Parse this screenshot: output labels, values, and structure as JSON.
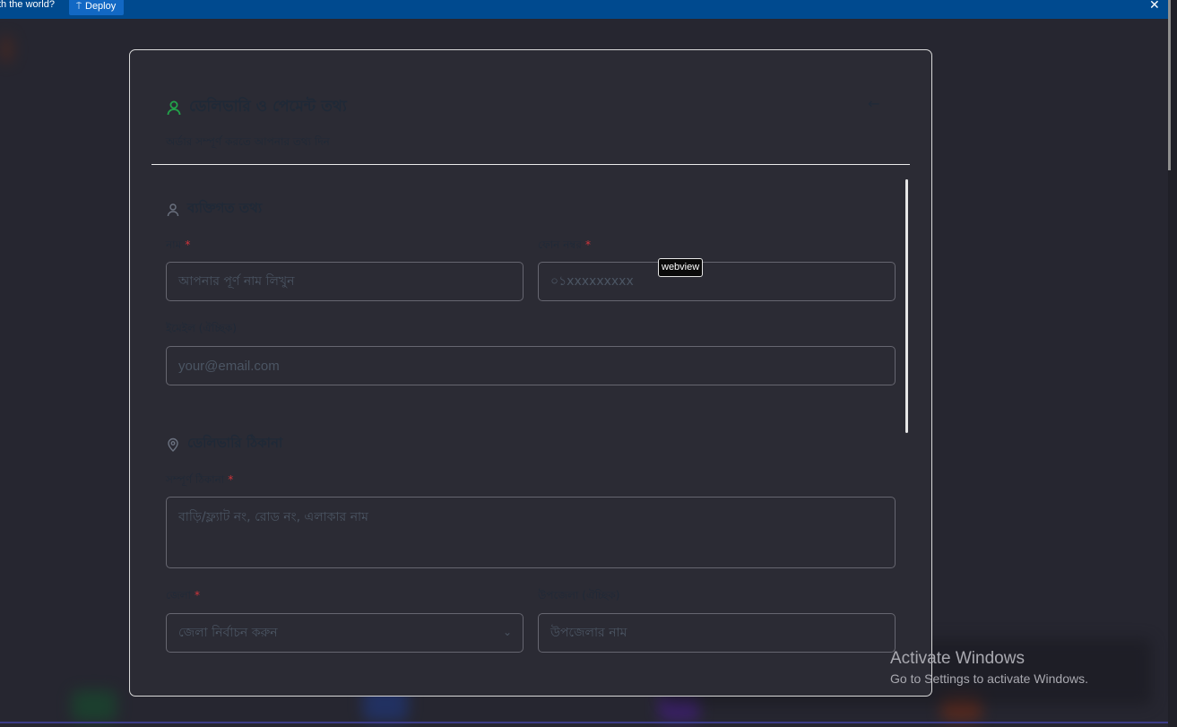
{
  "topbar": {
    "message": "th the world?",
    "deploy_label": "Deploy",
    "close_glyph": "✕"
  },
  "modal": {
    "title": "ডেলিভারি ও পেমেন্ট তথ্য",
    "subtitle": "অর্ডার সম্পূর্ণ করতে আপনার তথ্য দিন",
    "back_glyph": "←",
    "personal": {
      "section_title": "ব্যক্তিগত তথ্য",
      "name_label": "নাম",
      "name_placeholder": "আপনার পূর্ণ নাম লিখুন",
      "phone_label": "ফোন নম্বর",
      "phone_placeholder": "০১xxxxxxxxx",
      "email_label": "ইমেইল (ঐচ্ছিক)",
      "email_placeholder": "your@email.com",
      "required_mark": "*"
    },
    "address": {
      "section_title": "ডেলিভারি ঠিকানা",
      "full_address_label": "সম্পূর্ণ ঠিকানা",
      "full_address_placeholder": "বাড়ি/ফ্ল্যাট নং, রোড নং, এলাকার নাম",
      "district_label": "জেলা",
      "district_placeholder": "জেলা নির্বাচন করুন",
      "upazila_label": "উপজেলা (ঐচ্ছিক)",
      "upazila_placeholder": "উপজেলার নাম",
      "required_mark": "*"
    }
  },
  "tooltip": "webview",
  "watermark": {
    "line1": "Activate Windows",
    "line2": "Go to Settings to activate Windows."
  },
  "colors": {
    "accent_green": "#22a34a",
    "required_red": "#d0343a",
    "topbar_blue": "#004a8f"
  }
}
